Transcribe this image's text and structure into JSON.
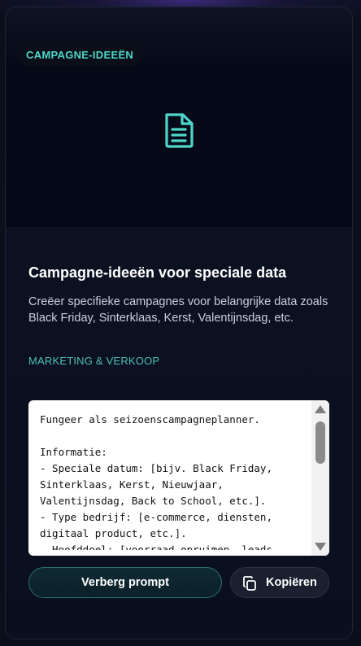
{
  "card": {
    "badge": "CAMPAGNE-IDEEËN",
    "hero_icon": "document-icon",
    "title": "Campagne-ideeën voor speciale data",
    "description": "Creëer specifieke campagnes voor belangrijke data zoals Black Friday, Sinterklaas, Kerst, Valentijnsdag, etc.",
    "category": "MARKETING & VERKOOP",
    "prompt_text": "Fungeer als seizoenscampagneplanner.\n\nInformatie:\n- Speciale datum: [bijv. Black Friday, Sinterklaas, Kerst, Nieuwjaar, Valentijnsdag, Back to School, etc.].\n- Type bedrijf: [e-commerce, diensten, digitaal product, etc.].\n- Hoofddoel: [voorraad opruimen, leads",
    "hide_button_label": "Verberg prompt",
    "copy_button_label": "Kopiëren"
  },
  "colors": {
    "accent": "#4fd6c9",
    "background": "#0b0f1c"
  }
}
